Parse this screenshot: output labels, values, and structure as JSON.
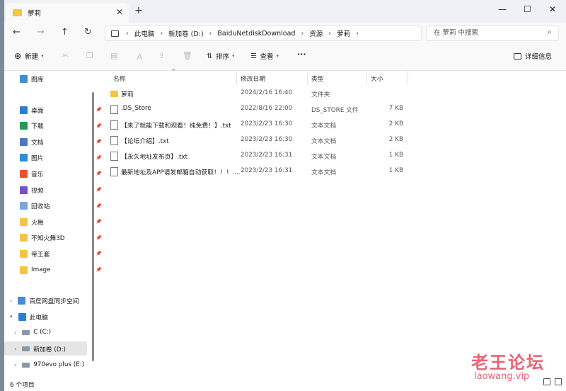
{
  "window": {
    "tab_title": "萝莉",
    "minimize": "—",
    "maximize": "☐",
    "close": "✕"
  },
  "address": {
    "crumbs": [
      "此电脑",
      "新加卷 (D:)",
      "BaiduNetdiskDownload",
      "资源",
      "萝莉"
    ],
    "search_placeholder": "在 萝莉 中搜索"
  },
  "toolbar": {
    "new_label": "新建",
    "sort_label": "排序",
    "view_label": "查看",
    "more": "···",
    "details_label": "详细信息"
  },
  "columns": {
    "name": "名称",
    "modified": "修改日期",
    "type": "类型",
    "size": "大小"
  },
  "files": [
    {
      "name": "萝莉",
      "modified": "2024/2/16 16:40",
      "type": "文件夹",
      "size": "",
      "kind": "folder"
    },
    {
      "name": ".DS_Store",
      "modified": "2022/8/16 22:00",
      "type": "DS_STORE 文件",
      "size": "7 KB",
      "kind": "file"
    },
    {
      "name": "【来了就能下载和观看！纯免费！】.txt",
      "modified": "2023/2/23 16:30",
      "type": "文本文档",
      "size": "2 KB",
      "kind": "txt"
    },
    {
      "name": "【论坛介绍】.txt",
      "modified": "2023/2/23 16:30",
      "type": "文本文档",
      "size": "2 KB",
      "kind": "txt"
    },
    {
      "name": "【永久地址发布页】.txt",
      "modified": "2023/2/23 16:31",
      "type": "文本文档",
      "size": "1 KB",
      "kind": "txt"
    },
    {
      "name": "最新地址及APP请发邮箱自动获取！！！....",
      "modified": "2023/2/23 16:31",
      "type": "文本文档",
      "size": "1 KB",
      "kind": "txt"
    }
  ],
  "sidebar": {
    "gallery": "图库",
    "pinned": [
      {
        "label": "桌面",
        "color": "#2f7dd1"
      },
      {
        "label": "下载",
        "color": "#1f9d55"
      },
      {
        "label": "文档",
        "color": "#4a78c2"
      },
      {
        "label": "图片",
        "color": "#2a8fd8"
      },
      {
        "label": "音乐",
        "color": "#e4572e"
      },
      {
        "label": "视频",
        "color": "#7b4fc9"
      },
      {
        "label": "回收站",
        "color": "#7aa6d8"
      },
      {
        "label": "火舞",
        "color": "#f4c542"
      },
      {
        "label": "不知火舞3D",
        "color": "#f4c542"
      },
      {
        "label": "帝王套",
        "color": "#f4c542"
      },
      {
        "label": "Image",
        "color": "#f4c542"
      }
    ],
    "baidu": "百度网盘同步空间",
    "this_pc": "此电脑",
    "drives": [
      {
        "label": "C (C:)"
      },
      {
        "label": "新加卷 (D:)"
      },
      {
        "label": "970evo plus (E:)"
      }
    ]
  },
  "status": {
    "count": "6 个项目"
  },
  "watermark": {
    "cn": "老王论坛",
    "en": "laowang.vip"
  }
}
